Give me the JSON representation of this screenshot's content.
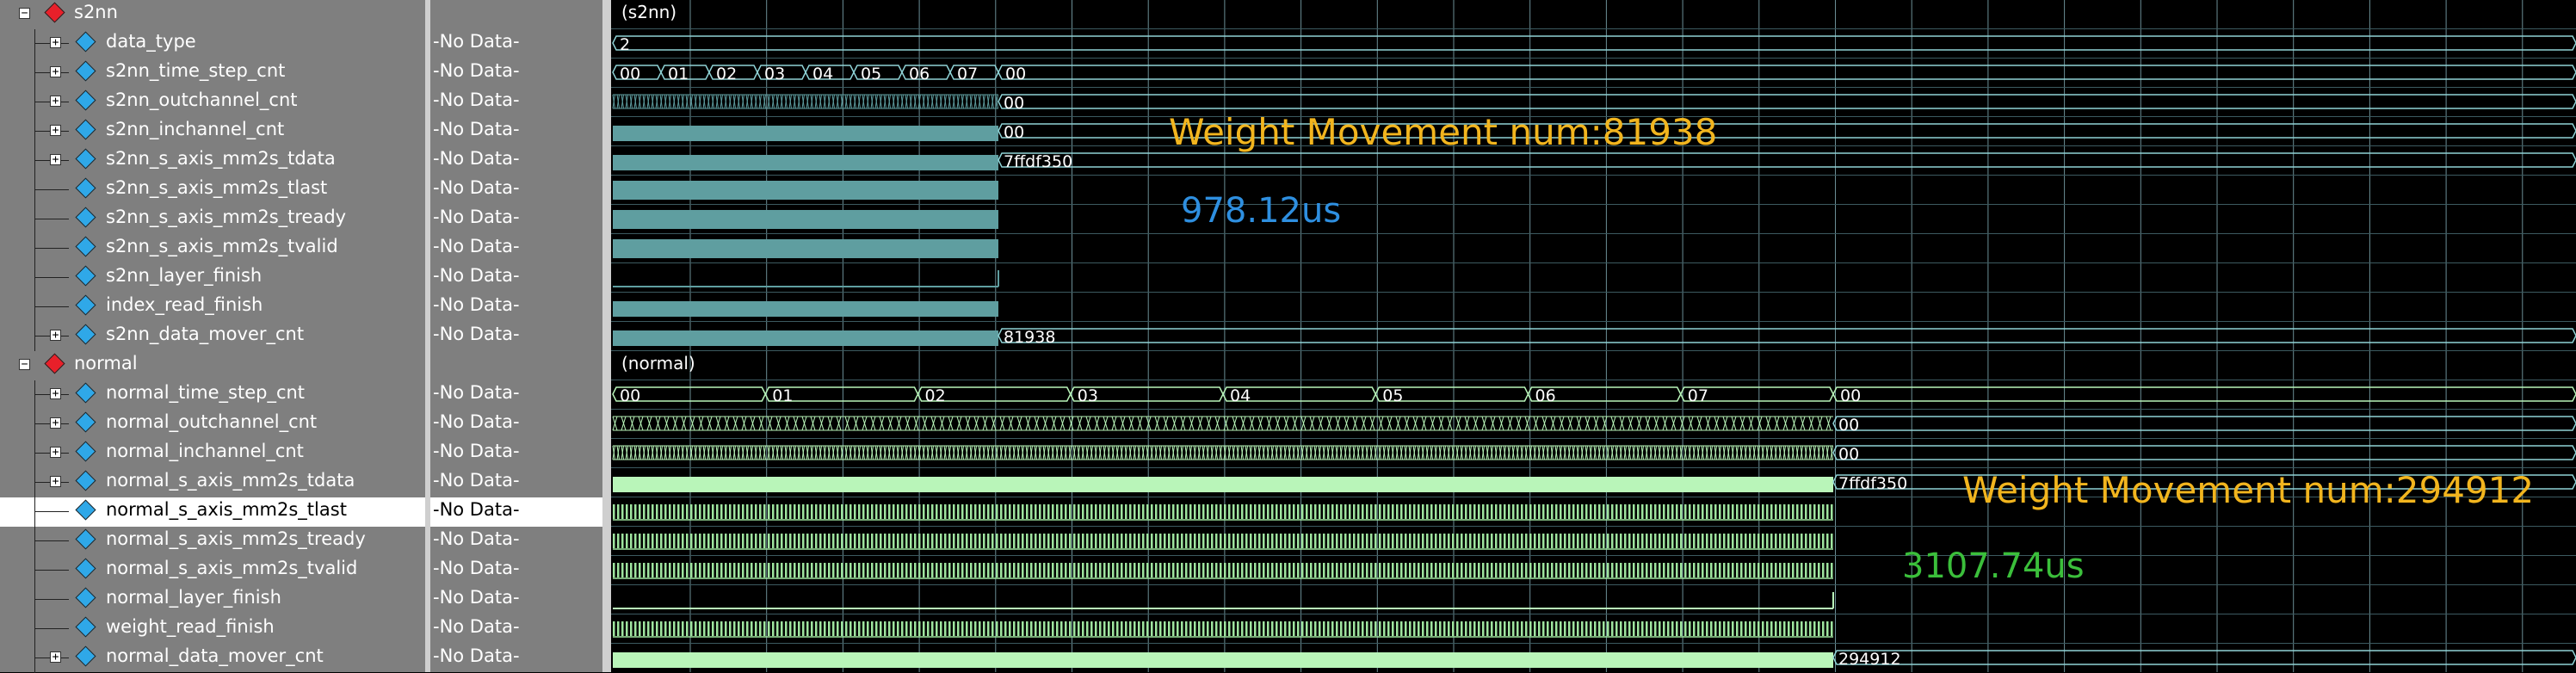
{
  "groups": [
    {
      "name": "s2nn",
      "label": "(s2nn)"
    },
    {
      "name": "normal",
      "label": "(normal)"
    }
  ],
  "signals": [
    {
      "name": "s2nn",
      "value": "",
      "kind": "group"
    },
    {
      "name": "data_type",
      "value": "-No Data-",
      "kind": "bus",
      "expand": true
    },
    {
      "name": "s2nn_time_step_cnt",
      "value": "-No Data-",
      "kind": "bus",
      "expand": true
    },
    {
      "name": "s2nn_outchannel_cnt",
      "value": "-No Data-",
      "kind": "bus",
      "expand": true
    },
    {
      "name": "s2nn_inchannel_cnt",
      "value": "-No Data-",
      "kind": "bus",
      "expand": true
    },
    {
      "name": "s2nn_s_axis_mm2s_tdata",
      "value": "-No Data-",
      "kind": "bus",
      "expand": true
    },
    {
      "name": "s2nn_s_axis_mm2s_tlast",
      "value": "-No Data-",
      "kind": "bit",
      "expand": false
    },
    {
      "name": "s2nn_s_axis_mm2s_tready",
      "value": "-No Data-",
      "kind": "bit",
      "expand": false
    },
    {
      "name": "s2nn_s_axis_mm2s_tvalid",
      "value": "-No Data-",
      "kind": "bit",
      "expand": false
    },
    {
      "name": "s2nn_layer_finish",
      "value": "-No Data-",
      "kind": "bit",
      "expand": false
    },
    {
      "name": "index_read_finish",
      "value": "-No Data-",
      "kind": "bit",
      "expand": false
    },
    {
      "name": "s2nn_data_mover_cnt",
      "value": "-No Data-",
      "kind": "bus",
      "expand": true
    },
    {
      "name": "normal",
      "value": "",
      "kind": "group"
    },
    {
      "name": "normal_time_step_cnt",
      "value": "-No Data-",
      "kind": "bus",
      "expand": true
    },
    {
      "name": "normal_outchannel_cnt",
      "value": "-No Data-",
      "kind": "bus",
      "expand": true
    },
    {
      "name": "normal_inchannel_cnt",
      "value": "-No Data-",
      "kind": "bus",
      "expand": true
    },
    {
      "name": "normal_s_axis_mm2s_tdata",
      "value": "-No Data-",
      "kind": "bus",
      "expand": true
    },
    {
      "name": "normal_s_axis_mm2s_tlast",
      "value": "-No Data-",
      "kind": "bit",
      "expand": false,
      "selected": true
    },
    {
      "name": "normal_s_axis_mm2s_tready",
      "value": "-No Data-",
      "kind": "bit",
      "expand": false
    },
    {
      "name": "normal_s_axis_mm2s_tvalid",
      "value": "-No Data-",
      "kind": "bit",
      "expand": false
    },
    {
      "name": "normal_layer_finish",
      "value": "-No Data-",
      "kind": "bit",
      "expand": false
    },
    {
      "name": "weight_read_finish",
      "value": "-No Data-",
      "kind": "bit",
      "expand": false
    },
    {
      "name": "normal_data_mover_cnt",
      "value": "-No Data-",
      "kind": "bus",
      "expand": true
    }
  ],
  "wave_labels": {
    "data_type": "2",
    "s2nn_time_step": [
      "00",
      "01",
      "02",
      "03",
      "04",
      "05",
      "06",
      "07",
      "00"
    ],
    "s2nn_outchannel_end": "00",
    "s2nn_inchannel_end": "00",
    "s2nn_tdata_end": "7ffdf350",
    "s2nn_mover_end": "81938",
    "normal_time_step": [
      "00",
      "01",
      "02",
      "03",
      "04",
      "05",
      "06",
      "07",
      "00"
    ],
    "normal_outchannel_end": "00",
    "normal_inchannel_end": "00",
    "normal_tdata_end": "7ffdf350",
    "normal_mover_end": "294912"
  },
  "annotations": {
    "s2nn_weight": "Weight Movement num:81938",
    "s2nn_time": "978.12us",
    "normal_weight": "Weight Movement num:294912",
    "normal_time": "3107.74us"
  },
  "colors": {
    "s2nn_wave": "#5f9ea0",
    "normal_wave": "#b9f5b9",
    "grid": "#6b8e95",
    "bus_line": "#8fd3d6",
    "orange_note": "#f2b51e",
    "blue_note": "#2e8fe0",
    "green_note": "#3bbf3b"
  }
}
